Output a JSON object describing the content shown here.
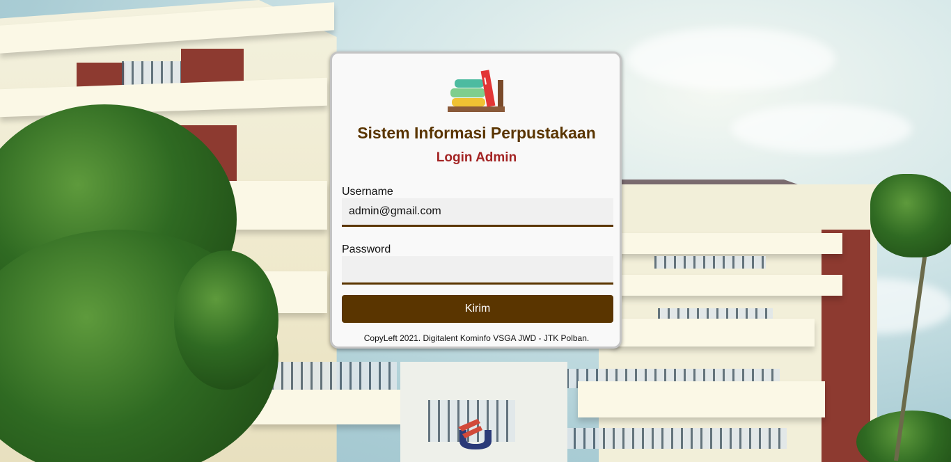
{
  "app": {
    "title": "Sistem Informasi Perpustakaan",
    "subtitle": "Login Admin"
  },
  "form": {
    "username_label": "Username",
    "username_value": "admin@gmail.com",
    "password_label": "Password",
    "password_value": "",
    "submit_label": "Kirim"
  },
  "footer": {
    "text": "CopyLeft 2021. Digitalent Kominfo VSGA JWD - JTK Polban."
  },
  "colors": {
    "brand_brown": "#5a3500",
    "accent_red": "#a32424",
    "card_bg": "#f9f9f9"
  },
  "icons": {
    "logo": "books-icon",
    "background": "campus-building-photo"
  }
}
